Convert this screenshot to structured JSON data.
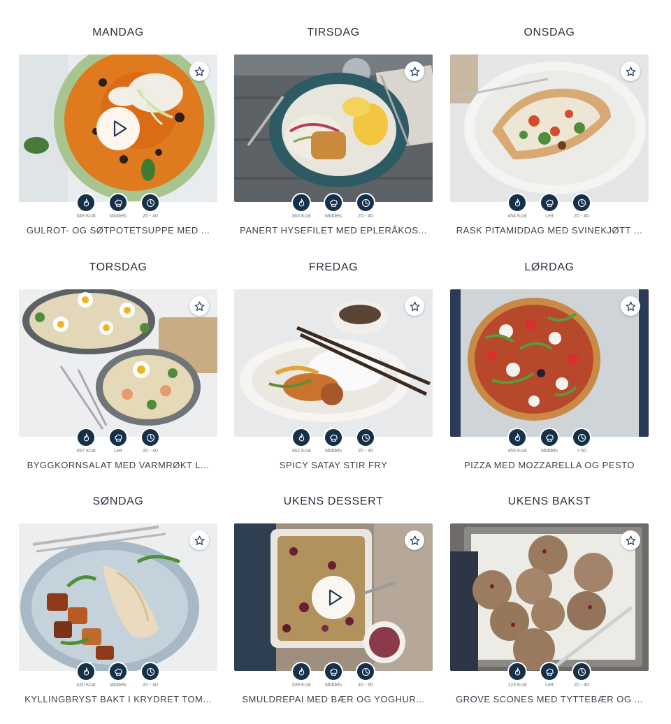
{
  "icons": {
    "favorite": "star-outline-icon",
    "play": "play-icon",
    "calories": "flame-icon",
    "difficulty": "chef-hat-icon",
    "time": "clock-icon"
  },
  "colors": {
    "icon_badge": "#15304a",
    "title_text": "#3a444e",
    "meta_text": "#6b7580"
  },
  "cards": [
    {
      "day": "MANDAG",
      "kcal": "349 Kcal",
      "difficulty": "Middels",
      "time": "20 - 40",
      "title": "GULROT- OG SØTPOTETSUPPE MED ...",
      "has_video": true
    },
    {
      "day": "TIRSDAG",
      "kcal": "363 Kcal",
      "difficulty": "Middels",
      "time": "20 - 40",
      "title": "PANERT HYSEFILET MED EPLERÅKOS...",
      "has_video": false
    },
    {
      "day": "ONSDAG",
      "kcal": "454 Kcal",
      "difficulty": "Lett",
      "time": "20 - 40",
      "title": "RASK PITAMIDDAG MED SVINEKJØTT ...",
      "has_video": false
    },
    {
      "day": "TORSDAG",
      "kcal": "457 Kcal",
      "difficulty": "Lett",
      "time": "20 - 40",
      "title": "BYGGKORNSALAT MED VARMRØKT L...",
      "has_video": false
    },
    {
      "day": "FREDAG",
      "kcal": "362 Kcal",
      "difficulty": "Middels",
      "time": "20 - 40",
      "title": "SPICY SATAY STIR FRY",
      "has_video": false
    },
    {
      "day": "LØRDAG",
      "kcal": "455 Kcal",
      "difficulty": "Middels",
      "time": "> 60",
      "title": "PIZZA MED MOZZARELLA OG PESTO",
      "has_video": false
    },
    {
      "day": "SØNDAG",
      "kcal": "420 Kcal",
      "difficulty": "Middels",
      "time": "20 - 40",
      "title": "KYLLINGBRYST BAKT I KRYDRET TOM...",
      "has_video": false
    },
    {
      "day": "UKENS DESSERT",
      "kcal": "339 Kcal",
      "difficulty": "Middels",
      "time": "40 - 60",
      "title": "SMULDREPAI MED BÆR OG YOGHUR...",
      "has_video": true
    },
    {
      "day": "UKENS BAKST",
      "kcal": "123 Kcal",
      "difficulty": "Lett",
      "time": "20 - 40",
      "title": "GROVE SCONES MED TYTTEBÆR OG ...",
      "has_video": false
    }
  ]
}
